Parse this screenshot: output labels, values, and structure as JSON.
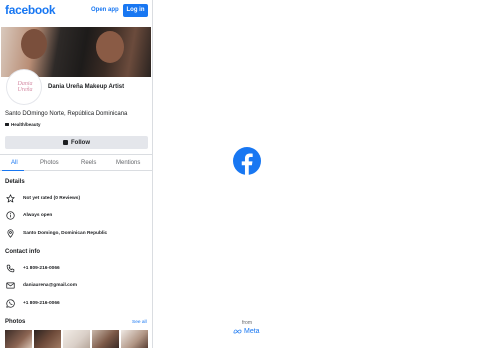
{
  "topbar": {
    "logo": "facebook",
    "open_app": "Open app",
    "login": "Log in"
  },
  "profile": {
    "name": "Dania Ureña Makeup Artist",
    "location": "Santo DOmingo Norte, República Dominicana",
    "category": "Health/beauty",
    "follow_label": "Follow",
    "avatar_monogram": "Dania Ureña"
  },
  "tabs": [
    "All",
    "Photos",
    "Reels",
    "Mentions"
  ],
  "details": {
    "heading": "Details",
    "rating": "Not yet rated (0 Reviews)",
    "hours": "Always open",
    "address": "Santo Domingo, Dominican Republic"
  },
  "contact": {
    "heading": "Contact info",
    "phone": "+1 809-216-0066",
    "email": "daniaurena@gmail.com",
    "whatsapp": "+1 809-216-0066"
  },
  "photos": {
    "heading": "Photos",
    "see_all": "See all"
  },
  "footer": {
    "from": "from",
    "meta": "Meta"
  },
  "colors": {
    "brand": "#1877f2",
    "button_bg": "#e4e6eb",
    "text": "#1c1e21",
    "muted": "#65676b"
  }
}
